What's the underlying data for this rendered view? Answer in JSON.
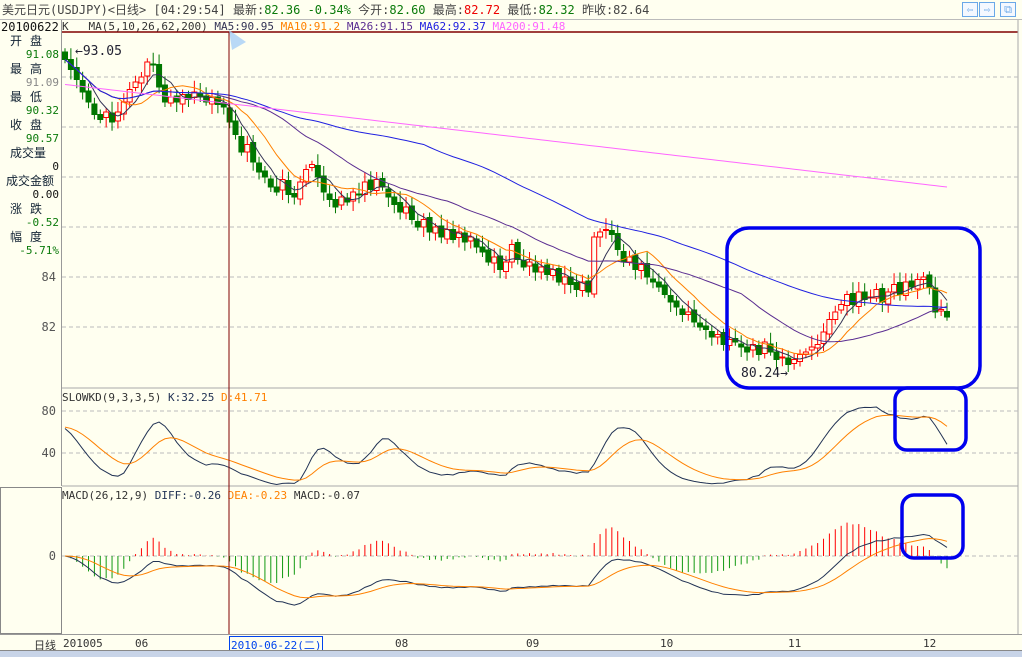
{
  "title": {
    "name": "美元日元(USDJPY)<日线>",
    "time": "[04:29:54]",
    "latest_label": "最新:",
    "latest": "82.36",
    "change": "-0.34%",
    "open_label": "今开:",
    "open": "82.60",
    "high_label": "最高:",
    "high": "82.72",
    "low_label": "最低:",
    "low": "82.32",
    "prev_label": "昨收:",
    "prev": "82.64"
  },
  "nav": {
    "back": "⇦",
    "forward": "⇨",
    "restore": "⧉"
  },
  "info": {
    "date": "20100622",
    "rows": [
      {
        "label": "开盘",
        "value": "91.08",
        "color": "#0a7a0a"
      },
      {
        "label": "最高",
        "value": "91.09",
        "color": "#888888"
      },
      {
        "label": "最低",
        "value": "90.32",
        "color": "#0a7a0a"
      },
      {
        "label": "收盘",
        "value": "90.57",
        "color": "#0a7a0a"
      },
      {
        "label": "成交量",
        "value": "0",
        "color": "#111111"
      },
      {
        "label": "成交金额",
        "value": "0.00",
        "color": "#111111"
      },
      {
        "label": "涨跌",
        "value": "-0.52",
        "color": "#0a7a0a"
      },
      {
        "label": "幅度",
        "value": "-5.71%",
        "color": "#0a7a0a"
      }
    ]
  },
  "legend": {
    "k": "K",
    "ma": "MA(5,10,26,62,200)",
    "ma5": "MA5:90.95",
    "ma10": "MA10:91.2",
    "ma26": "MA26:91.15",
    "ma62": "MA62:92.37",
    "ma200": "MA200:91.48"
  },
  "kd": {
    "name": "SLOWKD(9,3,3,5)",
    "k": "K:32.25",
    "d": "D:41.71"
  },
  "macd": {
    "name": "MACD(26,12,9)",
    "diff": "DIFF:-0.26",
    "dea": "DEA:-0.23",
    "macd": "MACD:-0.07"
  },
  "xaxis": {
    "label": "日线",
    "ticks": [
      "201005",
      "06",
      "08",
      "09",
      "10",
      "11",
      "12"
    ],
    "cursor": "2010-06-22(二)"
  },
  "colors": {
    "up": "#ff0000",
    "down": "#007700",
    "ma5": "#333355",
    "ma10": "#ff8000",
    "ma26": "#5a2d91",
    "ma62": "#2020e0",
    "ma200": "#ff66ff",
    "annotation": "#0000ee",
    "kline": "#223355",
    "dline": "#ff8000"
  },
  "chart_data": {
    "type": "candlestick",
    "y_ticks": [
      "84",
      "82"
    ],
    "kd_ticks": [
      "80",
      "40"
    ],
    "macd_ticks": [
      "0"
    ],
    "annotations": [
      "80.24",
      "93.05"
    ],
    "ma200_range": [
      91.7,
      87.6
    ],
    "closes": [
      92.7,
      92.3,
      91.9,
      91.4,
      91.0,
      90.5,
      90.3,
      90.6,
      90.2,
      90.6,
      91.0,
      91.5,
      91.8,
      92.0,
      92.6,
      92.5,
      91.6,
      91.0,
      91.2,
      91.0,
      91.3,
      91.1,
      91.4,
      91.2,
      91.0,
      91.2,
      90.9,
      90.8,
      90.2,
      89.7,
      89.0,
      89.3,
      88.6,
      88.2,
      88.0,
      87.6,
      87.4,
      87.9,
      87.3,
      87.2,
      87.8,
      88.3,
      88.5,
      88.0,
      87.4,
      87.1,
      86.8,
      87.2,
      87.0,
      87.4,
      87.3,
      87.8,
      87.5,
      87.9,
      87.6,
      87.2,
      86.9,
      86.6,
      86.8,
      86.3,
      86.0,
      86.3,
      85.8,
      86.0,
      85.6,
      85.9,
      85.5,
      85.8,
      85.4,
      85.6,
      85.2,
      85.0,
      84.6,
      84.8,
      84.3,
      84.6,
      85.3,
      84.7,
      84.4,
      84.6,
      84.2,
      84.4,
      84.1,
      84.3,
      83.8,
      84.0,
      83.7,
      83.5,
      83.8,
      83.4,
      85.6,
      85.8,
      85.9,
      85.7,
      85.1,
      84.6,
      84.8,
      84.3,
      84.5,
      84.0,
      83.8,
      83.6,
      83.3,
      83.0,
      82.8,
      82.5,
      82.6,
      82.2,
      82.0,
      81.9,
      81.6,
      81.7,
      81.3,
      81.5,
      81.4,
      81.2,
      81.0,
      81.3,
      80.9,
      81.4,
      81.0,
      80.7,
      80.8,
      80.5,
      80.7,
      80.9,
      81.0,
      81.2,
      81.3,
      81.8,
      82.3,
      82.6,
      82.9,
      83.3,
      82.9,
      83.4,
      83.1,
      83.2,
      83.5,
      83.0,
      83.4,
      83.7,
      83.3,
      83.8,
      83.6,
      83.9,
      84.0,
      83.6,
      82.6,
      82.7,
      82.4
    ]
  }
}
